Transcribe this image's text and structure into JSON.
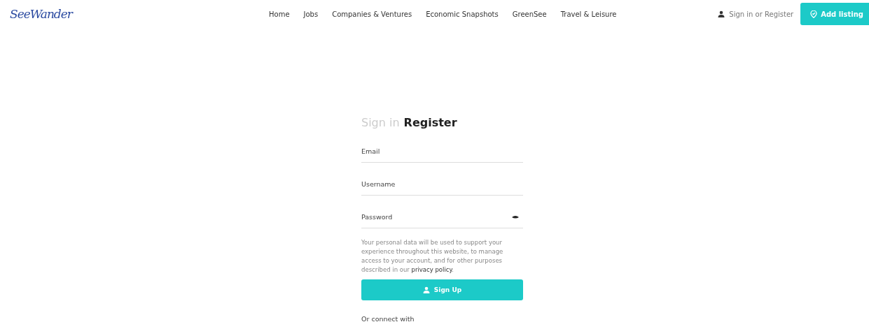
{
  "header": {
    "logo": "SeeWander",
    "nav": [
      {
        "label": "Home"
      },
      {
        "label": "Jobs"
      },
      {
        "label": "Companies & Ventures"
      },
      {
        "label": "Economic Snapshots"
      },
      {
        "label": "GreenSee"
      },
      {
        "label": "Travel & Leisure"
      }
    ],
    "account_link": "Sign in or Register",
    "add_button": "Add listing"
  },
  "form": {
    "tabs": [
      {
        "label": "Sign in",
        "selected": false
      },
      {
        "label": "Register",
        "selected": true
      }
    ],
    "fields": [
      {
        "placeholder": "Email",
        "kind": "text"
      },
      {
        "placeholder": "Username",
        "kind": "text"
      },
      {
        "placeholder": "Password",
        "kind": "password"
      }
    ],
    "notice": {
      "text": "Your personal data will be used to support your experience throughout this website, to manage access to your account, and for other purposes described in our ",
      "link": "privacy policy",
      "after": "."
    },
    "submit": "Sign Up",
    "connect_label": "Or connect with"
  }
}
